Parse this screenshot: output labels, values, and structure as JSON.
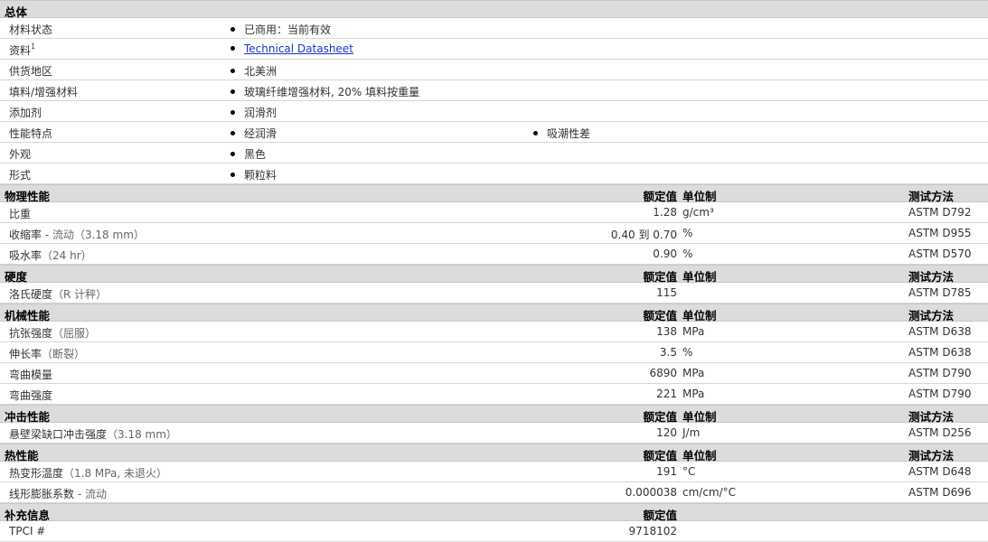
{
  "general": {
    "title": "总体",
    "rows": [
      {
        "label": "材料状态",
        "sup": "",
        "values": [
          "已商用：当前有效"
        ]
      },
      {
        "label": "资料",
        "sup": "1",
        "values": [
          "Technical Datasheet"
        ],
        "link": true
      },
      {
        "label": "供货地区",
        "sup": "",
        "values": [
          "北美洲"
        ]
      },
      {
        "label": "填料/增强材料",
        "sup": "",
        "values": [
          "玻璃纤维增强材料, 20% 填料按重量"
        ]
      },
      {
        "label": "添加剂",
        "sup": "",
        "values": [
          "润滑剂"
        ]
      },
      {
        "label": "性能特点",
        "sup": "",
        "values": [
          "经润滑",
          "吸潮性差"
        ]
      },
      {
        "label": "外观",
        "sup": "",
        "values": [
          "黑色"
        ]
      },
      {
        "label": "形式",
        "sup": "",
        "values": [
          "颗粒料"
        ]
      }
    ]
  },
  "headers": {
    "nominal": "额定值",
    "unit": "单位制",
    "method": "测试方法"
  },
  "sections": [
    {
      "title": "物理性能",
      "show_unit": true,
      "show_method": true,
      "rows": [
        {
          "label": "比重",
          "note": "",
          "value": "1.28",
          "unit": "g/cm³",
          "method": "ASTM D792"
        },
        {
          "label": "收缩率",
          "note": " - 流动（3.18 mm）",
          "value": "0.40 到  0.70",
          "unit": "%",
          "method": "ASTM D955"
        },
        {
          "label": "吸水率",
          "note": "（24 hr）",
          "value": "0.90",
          "unit": "%",
          "method": "ASTM D570"
        }
      ]
    },
    {
      "title": "硬度",
      "show_unit": true,
      "show_method": true,
      "rows": [
        {
          "label": "洛氏硬度",
          "note": "（R 计秤）",
          "value": "115",
          "unit": "",
          "method": "ASTM D785"
        }
      ]
    },
    {
      "title": "机械性能",
      "show_unit": true,
      "show_method": true,
      "rows": [
        {
          "label": "抗张强度",
          "note": "（屈服）",
          "value": "138",
          "unit": "MPa",
          "method": "ASTM D638"
        },
        {
          "label": "伸长率",
          "note": "（断裂）",
          "value": "3.5",
          "unit": "%",
          "method": "ASTM D638"
        },
        {
          "label": "弯曲模量",
          "note": "",
          "value": "6890",
          "unit": "MPa",
          "method": "ASTM D790"
        },
        {
          "label": "弯曲强度",
          "note": "",
          "value": "221",
          "unit": "MPa",
          "method": "ASTM D790"
        }
      ]
    },
    {
      "title": "冲击性能",
      "show_unit": true,
      "show_method": true,
      "rows": [
        {
          "label": "悬壁梁缺口冲击强度",
          "note": "（3.18 mm）",
          "value": "120",
          "unit": "J/m",
          "method": "ASTM D256"
        }
      ]
    },
    {
      "title": "热性能",
      "show_unit": true,
      "show_method": true,
      "rows": [
        {
          "label": "热变形温度",
          "note": "（1.8 MPa, 未退火）",
          "value": "191",
          "unit": "°C",
          "method": "ASTM D648"
        },
        {
          "label": "线形膨胀系数",
          "note": " - 流动",
          "value": "0.000038",
          "unit": "cm/cm/°C",
          "method": "ASTM D696"
        }
      ]
    },
    {
      "title": "补充信息",
      "show_unit": false,
      "show_method": false,
      "rows": [
        {
          "label": "TPCI #",
          "note": "",
          "value": "9718102",
          "unit": "",
          "method": ""
        }
      ]
    }
  ]
}
